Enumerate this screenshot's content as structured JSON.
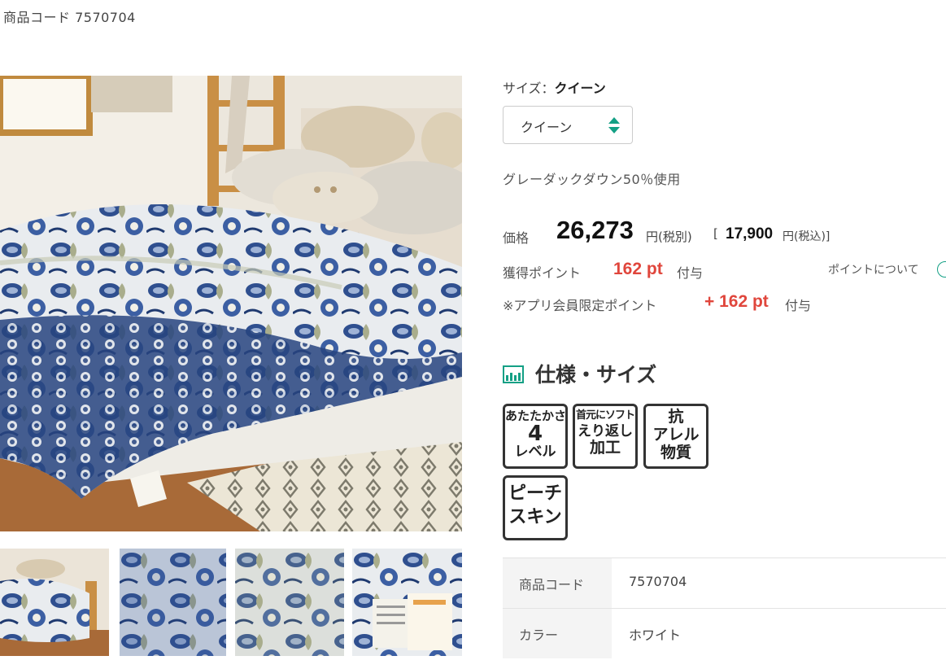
{
  "header": {
    "product_code_text": "商品コード 7570704"
  },
  "size": {
    "label": "サイズ：",
    "selected": "クイーン",
    "select_value": "クイーン"
  },
  "description": "グレーダックダウン50％使用",
  "price": {
    "label": "価格",
    "amount": "26,273",
    "unit_excl": "円(税別)",
    "bracket_open": "[",
    "tax_incl_amount": "17,900",
    "unit_incl": "円(税込)]"
  },
  "points": {
    "label": "獲得ポイント",
    "value": "162 pt",
    "suffix": "付与",
    "about_link": "ポイントについて"
  },
  "app_points": {
    "label": "※アプリ会員限定ポイント",
    "value": "+ 162 pt",
    "suffix": "付与"
  },
  "spec": {
    "title": "仕様・サイズ",
    "badges": [
      {
        "lines": [
          "あたたかさ",
          "4",
          "レベル"
        ]
      },
      {
        "lines": [
          "首元にソフト",
          "えり返し",
          "加工"
        ]
      },
      {
        "lines": [
          "抗",
          "アレル",
          "物質"
        ]
      },
      {
        "lines": [
          "ピーチ",
          "スキン"
        ]
      }
    ],
    "table": [
      {
        "key": "商品コード",
        "value": "7570704"
      },
      {
        "key": "カラー",
        "value": "ホワイト"
      }
    ]
  },
  "colors": {
    "accent": "#14a085",
    "point_red": "#e0463c",
    "duvet_blue": "#2f4f8f"
  }
}
